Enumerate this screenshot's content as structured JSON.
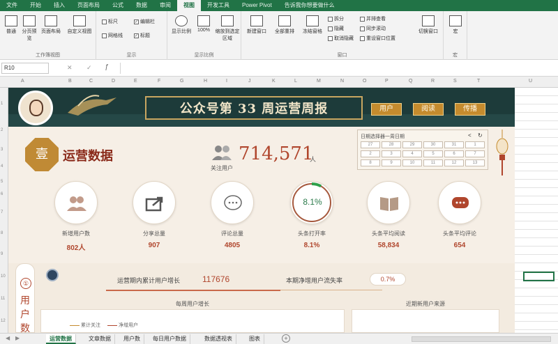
{
  "ribbon_tabs": [
    "文件",
    "开始",
    "插入",
    "页面布局",
    "公式",
    "数据",
    "审阅",
    "视图",
    "开发工具",
    "Power Pivot",
    "告诉我你想要做什么"
  ],
  "ribbon_active": "视图",
  "ribbon": {
    "workbook_views": {
      "normal": "普通",
      "page_break": "分页预览",
      "page_layout": "页面布局",
      "custom": "自定义视图",
      "group": "工作簿视图"
    },
    "show": {
      "ruler": "标尺",
      "formula_bar": "编辑栏",
      "gridlines": "网格线",
      "headings": "标题",
      "group": "显示"
    },
    "zoom": {
      "zoom": "显示比例",
      "pct": "100%",
      "to_sel": "缩放到选定区域",
      "group": "显示比例"
    },
    "window": {
      "new": "新建窗口",
      "arrange": "全部重排",
      "freeze": "冻结窗格",
      "split": "拆分",
      "hide": "隐藏",
      "unhide": "取消隐藏",
      "side": "并排查看",
      "sync": "同步滚动",
      "reset": "重设窗口位置",
      "switch": "切换窗口",
      "group": "窗口"
    },
    "macros": {
      "label": "宏",
      "group": "宏"
    }
  },
  "namebox": "R10",
  "dashboard": {
    "title": "公众号第 33 周运营周报",
    "buttons": [
      "用户",
      "阅读",
      "传播"
    ],
    "section_num": "壹",
    "section_title": "运营数据",
    "fans_label": "关注用户",
    "fans_value": "714,571",
    "fans_unit": "人",
    "calendar_title": "日期选择器一周日期",
    "calendar_cells": [
      "27",
      "28",
      "29",
      "30",
      "31",
      "1",
      "2",
      "3",
      "4",
      "5",
      "6",
      "7",
      "8",
      "9",
      "10",
      "11",
      "12",
      "13"
    ],
    "metrics": [
      {
        "label": "新增用户数",
        "value": "802人",
        "icon": "users-icon"
      },
      {
        "label": "分享总量",
        "value": "907",
        "icon": "share-icon"
      },
      {
        "label": "评论总量",
        "value": "4805",
        "icon": "comment-icon"
      },
      {
        "label": "头条打开率",
        "value": "8.1%",
        "icon": "open-rate-ring",
        "ring_text": "8.1%",
        "ring_fraction": 0.081
      },
      {
        "label": "头条平均阅读",
        "value": "58,834",
        "icon": "book-icon"
      },
      {
        "label": "头条平均评论",
        "value": "654",
        "icon": "chat-icon"
      }
    ],
    "side_tab": {
      "num": "①",
      "chars": [
        "用",
        "户",
        "数"
      ]
    },
    "growth_label": "运营期内累计用户增长",
    "growth_value": "117676",
    "churn_label": "本期净增用户流失率",
    "churn_value": "0.7%",
    "panel_left_title": "每周用户增长",
    "panel_right_title": "近期新用户来源",
    "legend": [
      "累计关注",
      "净增用户"
    ]
  },
  "sheet_tabs": [
    "运营数据",
    "文章数据",
    "用户数",
    "每日用户数据",
    "数据透视表",
    "图表"
  ],
  "sheet_active": "运营数据",
  "colors": {
    "excel_green": "#217346",
    "accent_red": "#b0462d",
    "gold": "#c58b2e",
    "banner": "#1d3b3a"
  }
}
